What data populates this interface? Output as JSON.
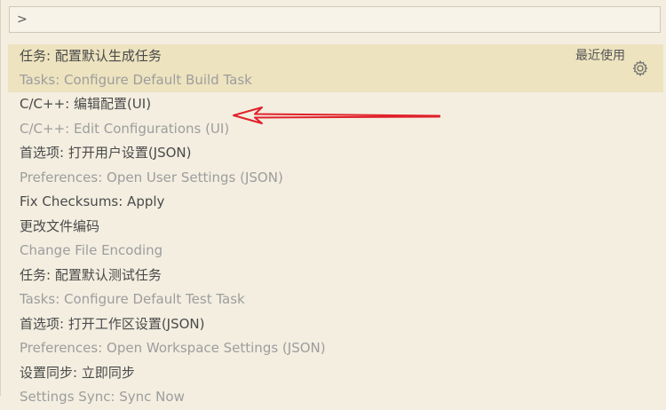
{
  "search": {
    "value": ">",
    "placeholder": ""
  },
  "commands": [
    {
      "label": "任务: 配置默认生成任务",
      "detail": "Tasks: Configure Default Build Task",
      "recent": "最近使用",
      "selected": true
    },
    {
      "label": "C/C++: 编辑配置(UI)",
      "detail": "C/C++: Edit Configurations (UI)"
    },
    {
      "label": "首选项: 打开用户设置(JSON)",
      "detail": "Preferences: Open User Settings (JSON)"
    },
    {
      "label": "Fix Checksums: Apply",
      "detail": ""
    },
    {
      "label": "更改文件编码",
      "detail": "Change File Encoding"
    },
    {
      "label": "任务: 配置默认测试任务",
      "detail": "Tasks: Configure Default Test Task"
    },
    {
      "label": "首选项: 打开工作区设置(JSON)",
      "detail": "Preferences: Open Workspace Settings (JSON)"
    },
    {
      "label": "设置同步: 立即同步",
      "detail": "Settings Sync: Sync Now"
    }
  ],
  "icons": {
    "gear": "gear-icon",
    "arrow": "annotation-arrow"
  },
  "colors": {
    "background": "#f3eee0",
    "selected": "#ede3bf",
    "arrow": "#e0202a"
  }
}
